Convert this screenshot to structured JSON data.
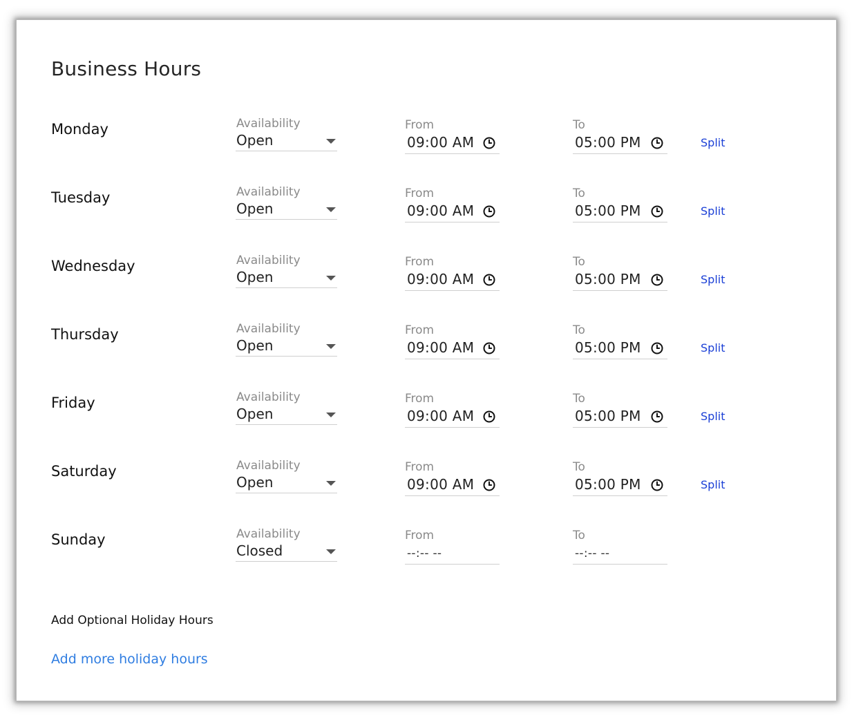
{
  "page": {
    "title": "Business Hours"
  },
  "labels": {
    "availability": "Availability",
    "from": "From",
    "to": "To",
    "split": "Split"
  },
  "days": [
    {
      "day": "Monday",
      "availability": "Open",
      "from": "09:00 AM",
      "to": "05:00 PM"
    },
    {
      "day": "Tuesday",
      "availability": "Open",
      "from": "09:00 AM",
      "to": "05:00 PM"
    },
    {
      "day": "Wednesday",
      "availability": "Open",
      "from": "09:00 AM",
      "to": "05:00 PM"
    },
    {
      "day": "Thursday",
      "availability": "Open",
      "from": "09:00 AM",
      "to": "05:00 PM"
    },
    {
      "day": "Friday",
      "availability": "Open",
      "from": "09:00 AM",
      "to": "05:00 PM"
    },
    {
      "day": "Saturday",
      "availability": "Open",
      "from": "09:00 AM",
      "to": "05:00 PM"
    },
    {
      "day": "Sunday",
      "availability": "Closed",
      "from": "--:-- --",
      "to": "--:-- --"
    }
  ],
  "holiday": {
    "label": "Add Optional Holiday Hours",
    "link": "Add more holiday hours"
  },
  "icons": {
    "clock": "clock-icon",
    "caret": "chevron-down-icon"
  },
  "colors": {
    "link": "#2f7de1",
    "split": "#1a3fd6"
  }
}
